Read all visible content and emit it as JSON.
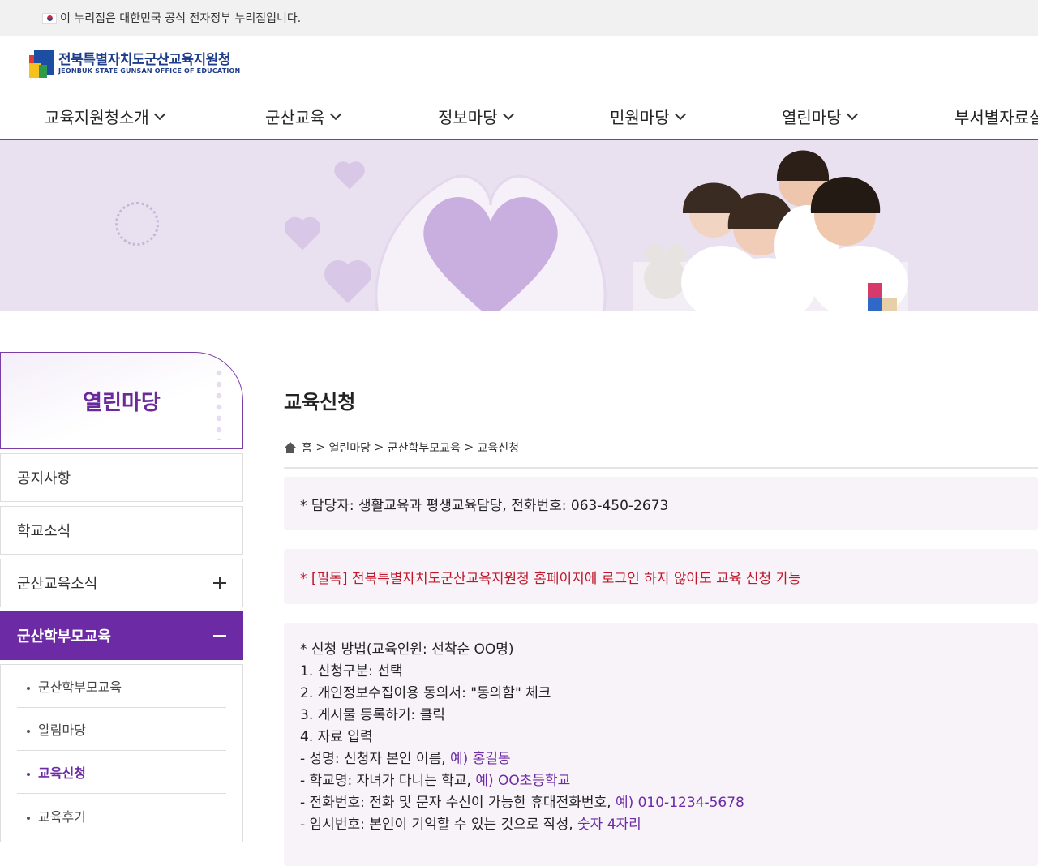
{
  "gov_banner": {
    "text": "이 누리집은 대한민국 공식 전자정부 누리집입니다."
  },
  "logo": {
    "ko": "전북특별자치도군산교육지원청",
    "en": "JEONBUK STATE GUNSAN OFFICE OF EDUCATION"
  },
  "nav": [
    "교육지원청소개",
    "군산교육",
    "정보마당",
    "민원마당",
    "열린마당",
    "부서별자료실"
  ],
  "sidebar": {
    "title": "열린마당",
    "menus": [
      "공지사항",
      "학교소식",
      "군산교육소식",
      "군산학부모교육"
    ],
    "sub_items": [
      "군산학부모교육",
      "알림마당",
      "교육신청",
      "교육후기"
    ]
  },
  "page": {
    "title": "교육신청",
    "breadcrumb": [
      "홈",
      "열린마당",
      "군산학부모교육",
      "교육신청"
    ],
    "contact": "* 담당자: 생활교육과 평생교육담당, 전화번호: 063-450-2673",
    "notice": "* [필독] 전북특별자치도군산교육지원청 홈페이지에 로그인 하지 않아도 교육 신청 가능",
    "steps": [
      "* 신청 방법(교육인원: 선착순 OO명)",
      "1. 신청구분: 선택",
      "2. 개인정보수집이용 동의서: \"동의함\" 체크",
      "3. 게시물 등록하기: 클릭",
      "4. 자료 입력"
    ],
    "fields": [
      {
        "label": "- 성명: 신청자 본인 이름, ",
        "example": "예) 홍길동"
      },
      {
        "label": "- 학교명: 자녀가 다니는 학교, ",
        "example": "예) OO초등학교"
      },
      {
        "label": "- 전화번호: 전화 및 문자 수신이 가능한 휴대전화번호, ",
        "example": "예) 010-1234-5678"
      },
      {
        "label": "- 임시번호: 본인이 기억할 수 있는 것으로 작성, ",
        "example": "숫자 4자리"
      }
    ]
  },
  "colors": {
    "accent": "#6c2aa5",
    "notice_red": "#c0182a",
    "box_bg": "#f7f3f9"
  }
}
